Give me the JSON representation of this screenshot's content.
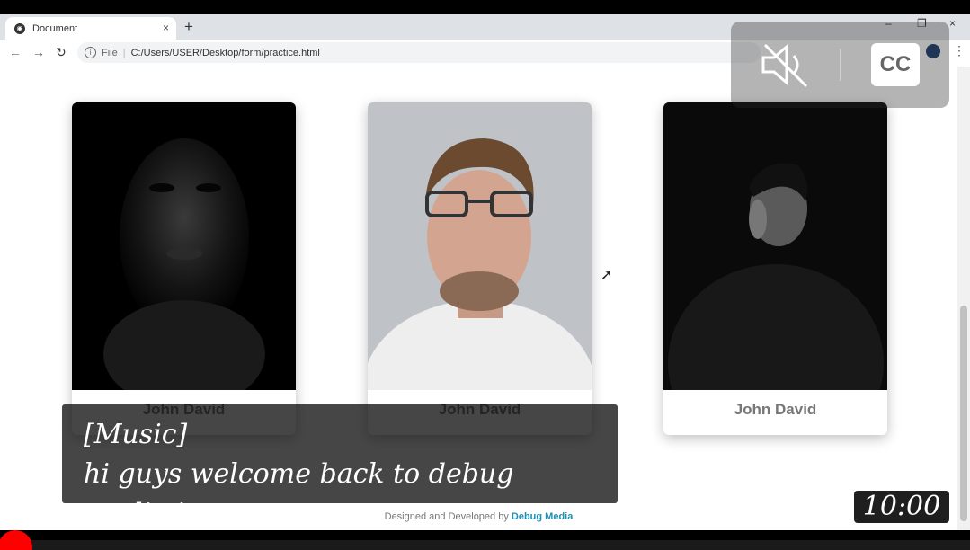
{
  "browser": {
    "tab_title": "Document",
    "tab_close": "×",
    "new_tab": "+",
    "url_file_label": "File",
    "url": "C:/Users/USER/Desktop/form/practice.html",
    "minimize": "–",
    "restore": "❐",
    "close": "×"
  },
  "cards": [
    {
      "name": "John David"
    },
    {
      "name": "John David"
    },
    {
      "name": "John David"
    }
  ],
  "footer": {
    "prefix": "Designed and Developed by",
    "brand": "Debug Media"
  },
  "video": {
    "caption_line1": "[Music]",
    "caption_line2": "hi guys welcome back to debug media in",
    "cc_label": "CC",
    "timestamp": "10:00",
    "muted": true
  }
}
